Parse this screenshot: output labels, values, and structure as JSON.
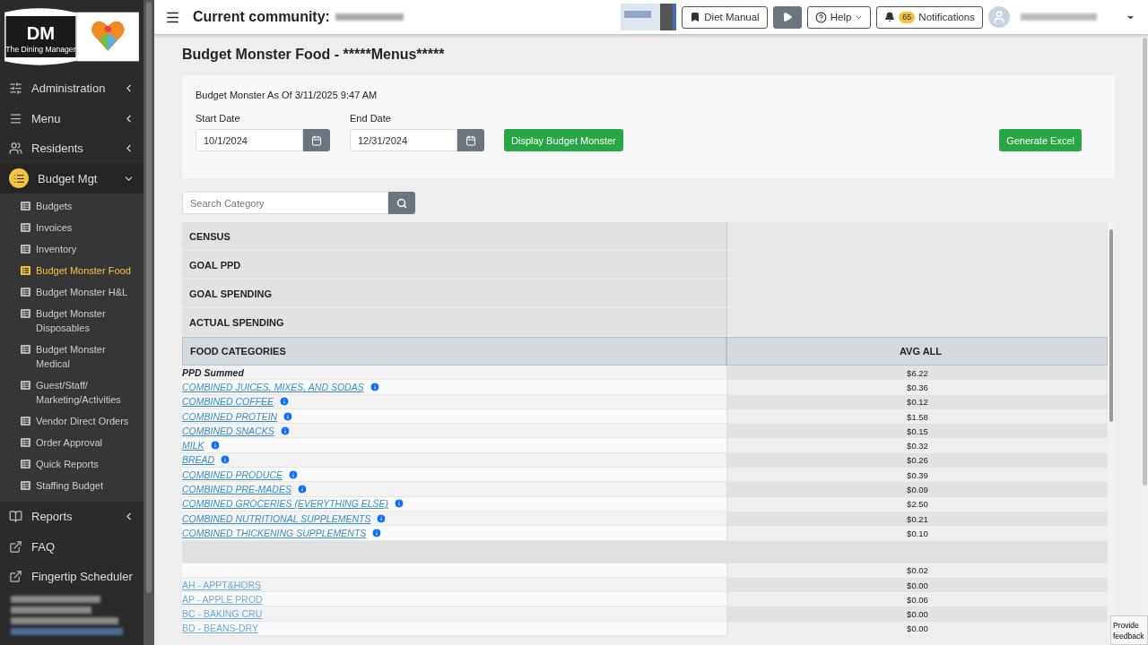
{
  "logo": {
    "mark": "DM",
    "tagline": "The Dining Manager"
  },
  "sidebar": {
    "items": [
      {
        "label": "Administration",
        "expanded": false
      },
      {
        "label": "Menu",
        "expanded": false
      },
      {
        "label": "Residents",
        "expanded": false
      },
      {
        "label": "Budget Mgt",
        "expanded": true,
        "children": [
          {
            "label": "Budgets",
            "selected": false
          },
          {
            "label": "Invoices",
            "selected": false
          },
          {
            "label": "Inventory",
            "selected": false
          },
          {
            "label": "Budget Monster Food",
            "selected": true
          },
          {
            "label": "Budget Monster H&L",
            "selected": false
          },
          {
            "label": "Budget Monster Disposables",
            "selected": false
          },
          {
            "label": "Budget Monster Medical",
            "selected": false
          },
          {
            "label": "Guest/Staff/ Marketing/Activities",
            "selected": false
          },
          {
            "label": "Vendor Direct Orders",
            "selected": false
          },
          {
            "label": "Order Approval",
            "selected": false
          },
          {
            "label": "Quick Reports",
            "selected": false
          },
          {
            "label": "Staffing Budget",
            "selected": false
          }
        ]
      },
      {
        "label": "Reports",
        "expanded": false
      },
      {
        "label": "FAQ"
      },
      {
        "label": "Fingertip Scheduler"
      }
    ]
  },
  "topbar": {
    "title": "Current community:",
    "buttons": [
      {
        "label": "Diet Manual",
        "kind": "bookmark"
      },
      {
        "kind": "play"
      },
      {
        "label": "Help",
        "kind": "help"
      },
      {
        "label": "Notifications",
        "kind": "bell",
        "badge": "65"
      }
    ]
  },
  "page": {
    "title": "Budget Monster Food - *****Menus*****",
    "filter": {
      "as_of": "Budget Monster As Of 3/11/2025 9:47 AM",
      "start_label": "Start Date",
      "start_value": "10/1/2024",
      "end_label": "End Date",
      "end_value": "12/31/2024",
      "display_button": "Display Budget Monster",
      "excel_button": "Generate Excel"
    },
    "search": {
      "placeholder": "Search Category"
    },
    "table": {
      "summary_rows": [
        "CENSUS",
        "GOAL PPD",
        "GOAL SPENDING",
        "ACTUAL SPENDING"
      ],
      "columns": [
        "FOOD CATEGORIES",
        "AVG ALL"
      ],
      "rows": [
        {
          "kind": "total",
          "label": "PPD Summed",
          "value": "$6.22"
        },
        {
          "kind": "category",
          "label": "COMBINED JUICES, MIXES, AND SODAS",
          "value": "$0.36"
        },
        {
          "kind": "category",
          "label": "COMBINED COFFEE",
          "value": "$0.12"
        },
        {
          "kind": "category",
          "label": "COMBINED PROTEIN",
          "value": "$1.58"
        },
        {
          "kind": "category",
          "label": "COMBINED SNACKS",
          "value": "$0.15"
        },
        {
          "kind": "category",
          "label": "MILK",
          "value": "$0.32"
        },
        {
          "kind": "category",
          "label": "BREAD",
          "value": "$0.26"
        },
        {
          "kind": "category",
          "label": "COMBINED PRODUCE",
          "value": "$0.39"
        },
        {
          "kind": "category",
          "label": "COMBINED PRE-MADES",
          "value": "$0.09"
        },
        {
          "kind": "category",
          "label": "COMBINED GROCERIES (EVERYTHING ELSE)",
          "value": "$2.50"
        },
        {
          "kind": "category",
          "label": "COMBINED NUTRITIONAL SUPPLEMENTS",
          "value": "$0.21"
        },
        {
          "kind": "category",
          "label": "COMBINED THICKENING SUPPLEMENTS",
          "value": "$0.10"
        },
        {
          "kind": "spacer"
        },
        {
          "kind": "item",
          "value": "$0.02"
        },
        {
          "kind": "item",
          "label": "AH - APPT&HORS",
          "value": "$0.00"
        },
        {
          "kind": "item",
          "label": "AP - APPLE PROD",
          "value": "$0.06"
        },
        {
          "kind": "item",
          "label": "BC - BAKING CRU",
          "value": "$0.00"
        },
        {
          "kind": "item",
          "label": "BD - BEANS-DRY",
          "value": "$0.00"
        }
      ]
    }
  },
  "feedback": "Provide feedback"
}
